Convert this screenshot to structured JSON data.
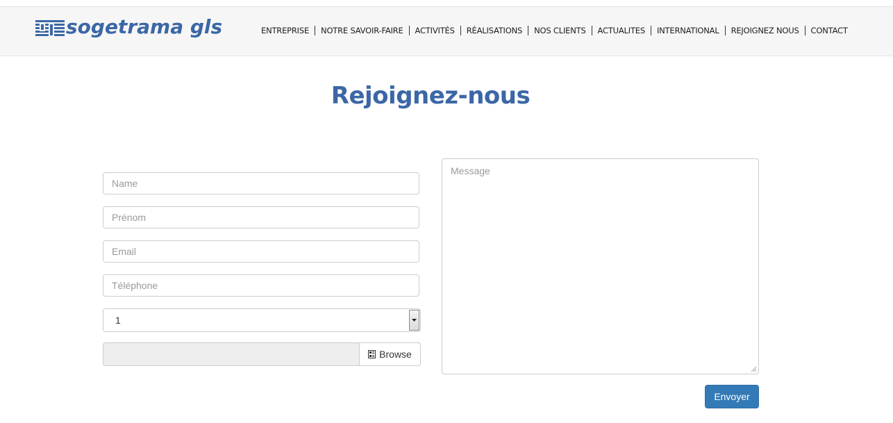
{
  "brand": {
    "logo_text": "sogetrama gls",
    "color": "#3b67a6"
  },
  "nav": {
    "items": [
      {
        "label": "ENTREPRISE"
      },
      {
        "label": "NOTRE SAVOIR-FAIRE"
      },
      {
        "label": "ACTIVITÉS"
      },
      {
        "label": "RÉALISATIONS"
      },
      {
        "label": "NOS CLIENTS"
      },
      {
        "label": "ACTUALITES"
      },
      {
        "label": "INTERNATIONAL"
      },
      {
        "label": "REJOIGNEZ NOUS"
      },
      {
        "label": "CONTACT"
      }
    ]
  },
  "page": {
    "title": "Rejoignez-nous"
  },
  "form": {
    "name_placeholder": "Name",
    "prenom_placeholder": "Prénom",
    "email_placeholder": "Email",
    "telephone_placeholder": "Téléphone",
    "select_value": "1",
    "file_value": "",
    "browse_label": "Browse",
    "message_placeholder": "Message",
    "submit_label": "Envoyer",
    "submit_color": "#337ab7"
  },
  "icons": {
    "browse": "file-icon",
    "select": "chevron-down-icon",
    "resize": "resize-grip-icon"
  }
}
